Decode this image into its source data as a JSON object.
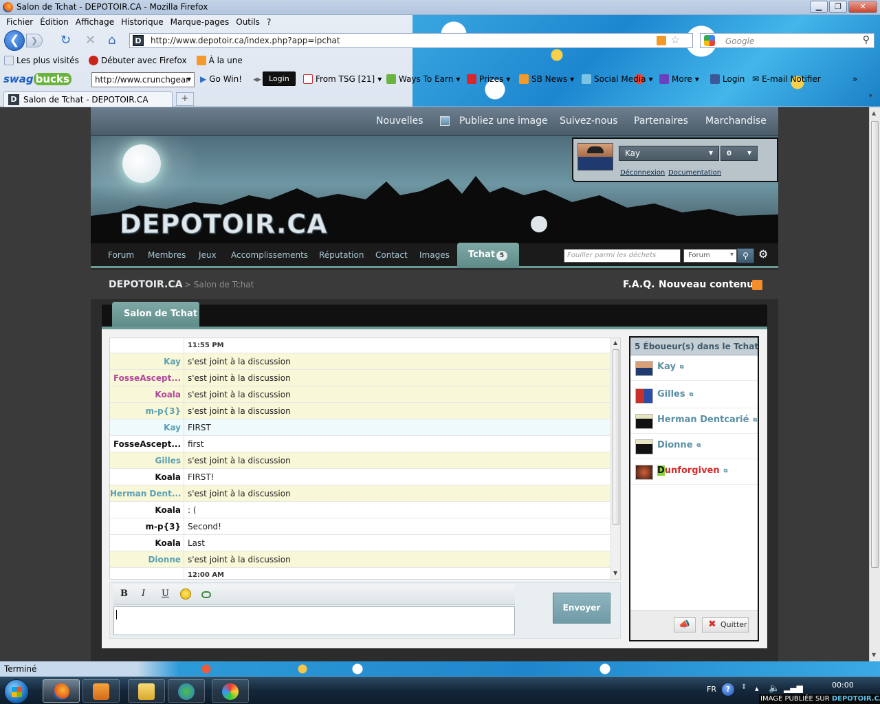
{
  "window": {
    "title": "Salon de Tchat - DEPOTOIR.CA - Mozilla Firefox"
  },
  "menu": [
    "Fichier",
    "Édition",
    "Affichage",
    "Historique",
    "Marque-pages",
    "Outils",
    "?"
  ],
  "nav": {
    "url": "http://www.depotoir.ca/index.php?app=ipchat",
    "search_placeholder": "Google",
    "favicon_letter": "D"
  },
  "bookmarks": [
    "Les plus visités",
    "Débuter avec Firefox",
    "À la une"
  ],
  "swagbar": {
    "logo_a": "swag",
    "logo_b": "bucks",
    "url_value": "http://www.crunchgear",
    "items": [
      "Go Win!",
      "Login",
      "From TSG [21]",
      "Ways To Earn",
      "Prizes",
      "SB News",
      "Social Media",
      "More",
      "Login",
      "E-mail Notifier"
    ]
  },
  "tab": {
    "title": "Salon de Tchat - DEPOTOIR.CA",
    "new_tab": "+"
  },
  "site": {
    "topnav": [
      "Nouvelles",
      "Publiez une image",
      "Suivez-nous",
      "Partenaires",
      "Marchandise"
    ],
    "logo": "DEPOTOIR.CA",
    "user": {
      "name": "Kay",
      "count": "0",
      "logout": "Déconnexion",
      "docs": "Documentation"
    },
    "mainnav": [
      "Forum",
      "Membres",
      "Jeux",
      "Accomplissements",
      "Réputation",
      "Contact",
      "Images"
    ],
    "tchat_tab": {
      "label": "Tchat",
      "badge": "5"
    },
    "search": {
      "placeholder": "Fouiller parmi les déchets",
      "scope": "Forum"
    },
    "breadcrumb": {
      "root": "DEPOTOIR.CA",
      "sep_current": "> Salon de Tchat"
    },
    "links_right": [
      "F.A.Q.",
      "Nouveau contenu"
    ]
  },
  "chat": {
    "tab_label": "Salon de Tchat",
    "colors": {
      "kay": "#5b9fb3",
      "fosse": "#b0479b",
      "koala": "#b0479b",
      "mp": "#5b9fb3",
      "gilles": "#5b9fb3",
      "herman": "#5b9fb3",
      "dionne": "#5b9fb3",
      "default": "#111111"
    },
    "messages": [
      {
        "type": "time",
        "who": "",
        "text": "11:55 PM"
      },
      {
        "type": "join",
        "who": "Kay",
        "color": "#5b9fb3",
        "text": "s'est joint à la discussion"
      },
      {
        "type": "join",
        "who": "FosseAscept...",
        "color": "#b0479b",
        "text": "s'est joint à la discussion"
      },
      {
        "type": "join",
        "who": "Koala",
        "color": "#b0479b",
        "text": "s'est joint à la discussion"
      },
      {
        "type": "join",
        "who": "m-p{3}",
        "color": "#5b9fb3",
        "text": "s'est joint à la discussion"
      },
      {
        "type": "me",
        "who": "Kay",
        "color": "#5b9fb3",
        "text": "FIRST"
      },
      {
        "type": "msg",
        "who": "FosseAscept...",
        "color": "#111111",
        "text": "first"
      },
      {
        "type": "join",
        "who": "Gilles",
        "color": "#5b9fb3",
        "text": "s'est joint à la discussion"
      },
      {
        "type": "msg",
        "who": "Koala",
        "color": "#111111",
        "text": "FIRST!"
      },
      {
        "type": "join",
        "who": "Herman Dent...",
        "color": "#5b9fb3",
        "text": "s'est joint à la discussion"
      },
      {
        "type": "msg",
        "who": "Koala",
        "color": "#111111",
        "text": ": ("
      },
      {
        "type": "msg",
        "who": "m-p{3}",
        "color": "#111111",
        "text": "Second!"
      },
      {
        "type": "msg",
        "who": "Koala",
        "color": "#111111",
        "text": "Last"
      },
      {
        "type": "join",
        "who": "Dionne",
        "color": "#5b9fb3",
        "text": "s'est joint à la discussion"
      },
      {
        "type": "time",
        "who": "",
        "text": "12:00 AM"
      }
    ],
    "format": {
      "bold": "B",
      "italic": "I",
      "underline": "U"
    },
    "send_label": "Envoyer",
    "users_title": "5 Éboueur(s) dans le Tchat",
    "users": [
      {
        "name": "Kay",
        "color": "#5b8fa3"
      },
      {
        "name": "Gilles",
        "color": "#5b8fa3"
      },
      {
        "name": "Herman Dentcarié",
        "color": "#5b8fa3"
      },
      {
        "name": "Dionne",
        "color": "#5b8fa3"
      },
      {
        "name": "unforgiven",
        "prefix": "D",
        "color": "#d42c2c"
      }
    ],
    "quit_label": "Quitter"
  },
  "status": {
    "text": "Terminé"
  },
  "taskbar": {
    "lang": "FR",
    "clock": "00:00",
    "credit_a": "IMAGE PUBLIÉE SUR ",
    "credit_b": "DEPOTOIR.CA"
  }
}
